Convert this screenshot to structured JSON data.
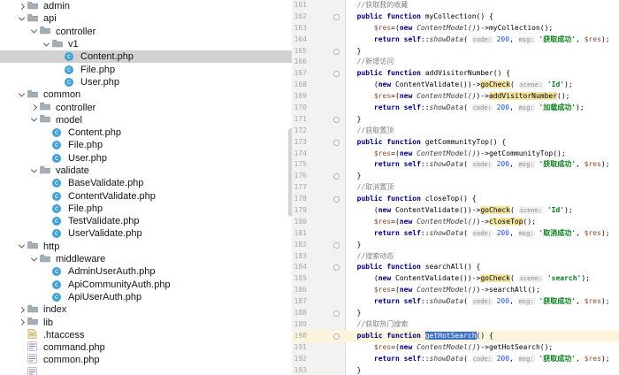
{
  "colors": {
    "tree_selection": "#D2D2D2",
    "caret_line": "#FCF5DB",
    "usage_highlight": "#F6E6A2",
    "selection_blue": "#3B6EC6",
    "keyword": "#000080",
    "string_green": "#067D17",
    "number_blue": "#1750EB",
    "variable_brown": "#8B4A2F",
    "comment_gray": "#808080",
    "class_icon_blue": "#41A1D3",
    "gutter_bg": "#F2F2F1"
  },
  "tree": {
    "items": [
      {
        "label": "admin",
        "level": 0,
        "kind": "folder",
        "chevron": "collapsed",
        "selected": false
      },
      {
        "label": "api",
        "level": 0,
        "kind": "folder",
        "chevron": "expanded",
        "selected": false
      },
      {
        "label": "controller",
        "level": 1,
        "kind": "folder",
        "chevron": "expanded",
        "selected": false
      },
      {
        "label": "v1",
        "level": 2,
        "kind": "folder",
        "chevron": "expanded",
        "selected": false
      },
      {
        "label": "Content.php",
        "level": 3,
        "kind": "class",
        "chevron": "none",
        "selected": true
      },
      {
        "label": "File.php",
        "level": 3,
        "kind": "class",
        "chevron": "none",
        "selected": false
      },
      {
        "label": "User.php",
        "level": 3,
        "kind": "class",
        "chevron": "none",
        "selected": false
      },
      {
        "label": "common",
        "level": 0,
        "kind": "folder",
        "chevron": "expanded",
        "selected": false
      },
      {
        "label": "controller",
        "level": 1,
        "kind": "folder",
        "chevron": "collapsed",
        "selected": false
      },
      {
        "label": "model",
        "level": 1,
        "kind": "folder",
        "chevron": "expanded",
        "selected": false
      },
      {
        "label": "Content.php",
        "level": 2,
        "kind": "class",
        "chevron": "none",
        "selected": false
      },
      {
        "label": "File.php",
        "level": 2,
        "kind": "class",
        "chevron": "none",
        "selected": false
      },
      {
        "label": "User.php",
        "level": 2,
        "kind": "class",
        "chevron": "none",
        "selected": false
      },
      {
        "label": "validate",
        "level": 1,
        "kind": "folder",
        "chevron": "expanded",
        "selected": false
      },
      {
        "label": "BaseValidate.php",
        "level": 2,
        "kind": "class",
        "chevron": "none",
        "selected": false
      },
      {
        "label": "ContentValidate.php",
        "level": 2,
        "kind": "class",
        "chevron": "none",
        "selected": false
      },
      {
        "label": "File.php",
        "level": 2,
        "kind": "class",
        "chevron": "none",
        "selected": false
      },
      {
        "label": "TestValidate.php",
        "level": 2,
        "kind": "class",
        "chevron": "none",
        "selected": false
      },
      {
        "label": "UserValidate.php",
        "level": 2,
        "kind": "class",
        "chevron": "none",
        "selected": false
      },
      {
        "label": "http",
        "level": 0,
        "kind": "folder",
        "chevron": "expanded",
        "selected": false
      },
      {
        "label": "middleware",
        "level": 1,
        "kind": "folder",
        "chevron": "expanded",
        "selected": false
      },
      {
        "label": "AdminUserAuth.php",
        "level": 2,
        "kind": "class",
        "chevron": "none",
        "selected": false
      },
      {
        "label": "ApiCommunityAuth.php",
        "level": 2,
        "kind": "class",
        "chevron": "none",
        "selected": false
      },
      {
        "label": "ApiUserAuth.php",
        "level": 2,
        "kind": "class",
        "chevron": "none",
        "selected": false
      },
      {
        "label": "index",
        "level": 0,
        "kind": "folder",
        "chevron": "collapsed",
        "selected": false
      },
      {
        "label": "lib",
        "level": 0,
        "kind": "folder",
        "chevron": "collapsed",
        "selected": false
      },
      {
        "label": ".htaccess",
        "level": 0,
        "kind": "htaccess",
        "chevron": "none",
        "selected": false
      },
      {
        "label": "command.php",
        "level": 0,
        "kind": "phpfile",
        "chevron": "none",
        "selected": false
      },
      {
        "label": "common.php",
        "level": 0,
        "kind": "phpfile",
        "chevron": "none",
        "selected": false
      },
      {
        "label": "",
        "level": 0,
        "kind": "phpfile",
        "chevron": "none",
        "selected": false
      }
    ]
  },
  "editor": {
    "caret_line": 190,
    "lines": [
      {
        "num": 161,
        "tokens": [
          [
            "cmt",
            "  //获取我的收藏"
          ]
        ]
      },
      {
        "num": 162,
        "fold": "start",
        "tokens": [
          [
            "kw",
            "  public function"
          ],
          [
            "pl",
            " "
          ],
          [
            "fn",
            "myCollection"
          ],
          [
            "pl",
            "() {"
          ]
        ]
      },
      {
        "num": 163,
        "tokens": [
          [
            "pl",
            "      "
          ],
          [
            "var",
            "$res"
          ],
          [
            "pl",
            "=("
          ],
          [
            "kw",
            "new"
          ],
          [
            "pl",
            " "
          ],
          [
            "cls",
            "ContentModel()"
          ],
          [
            "pl",
            ")->myCollection();"
          ]
        ]
      },
      {
        "num": 164,
        "tokens": [
          [
            "pl",
            "      "
          ],
          [
            "kw",
            "return self"
          ],
          [
            "pl",
            "::"
          ],
          [
            "cls",
            "showData"
          ],
          [
            "pl",
            "( "
          ],
          [
            "hint",
            "code:"
          ],
          [
            "pl",
            " "
          ],
          [
            "num",
            "200"
          ],
          [
            "pl",
            ", "
          ],
          [
            "hint",
            "msg:"
          ],
          [
            "pl",
            " "
          ],
          [
            "str",
            "'获取成功'"
          ],
          [
            "pl",
            ", "
          ],
          [
            "var",
            "$res"
          ],
          [
            "pl",
            ");"
          ]
        ]
      },
      {
        "num": 165,
        "fold": "end",
        "tokens": [
          [
            "pl",
            "  }"
          ]
        ]
      },
      {
        "num": 166,
        "tokens": [
          [
            "cmt",
            "  //新增访问"
          ]
        ]
      },
      {
        "num": 167,
        "fold": "start",
        "tokens": [
          [
            "kw",
            "  public function"
          ],
          [
            "pl",
            " "
          ],
          [
            "fn",
            "addVisitorNumber"
          ],
          [
            "pl",
            "() {"
          ]
        ]
      },
      {
        "num": 168,
        "tokens": [
          [
            "pl",
            "      ("
          ],
          [
            "kw",
            "new"
          ],
          [
            "pl",
            " ContentValidate())->"
          ],
          [
            "hl",
            "goCheck"
          ],
          [
            "pl",
            "( "
          ],
          [
            "hint",
            "scene:"
          ],
          [
            "pl",
            " "
          ],
          [
            "str",
            "'Id'"
          ],
          [
            "pl",
            ");"
          ]
        ]
      },
      {
        "num": 169,
        "tokens": [
          [
            "pl",
            "      "
          ],
          [
            "var",
            "$res"
          ],
          [
            "pl",
            "=("
          ],
          [
            "kw",
            "new"
          ],
          [
            "pl",
            " "
          ],
          [
            "cls",
            "ContentModel()"
          ],
          [
            "pl",
            ")->"
          ],
          [
            "hl",
            "addVisitorNumber"
          ],
          [
            "pl",
            "();"
          ]
        ]
      },
      {
        "num": 170,
        "tokens": [
          [
            "pl",
            "      "
          ],
          [
            "kw",
            "return self"
          ],
          [
            "pl",
            "::"
          ],
          [
            "cls",
            "showData"
          ],
          [
            "pl",
            "( "
          ],
          [
            "hint",
            "code:"
          ],
          [
            "pl",
            " "
          ],
          [
            "num",
            "200"
          ],
          [
            "pl",
            ", "
          ],
          [
            "hint",
            "msg:"
          ],
          [
            "pl",
            " "
          ],
          [
            "str",
            "'加载成功'"
          ],
          [
            "pl",
            ");"
          ]
        ]
      },
      {
        "num": 171,
        "fold": "end",
        "tokens": [
          [
            "pl",
            "  }"
          ]
        ]
      },
      {
        "num": 172,
        "tokens": [
          [
            "cmt",
            "  //获取置顶"
          ]
        ]
      },
      {
        "num": 173,
        "fold": "start",
        "tokens": [
          [
            "kw",
            "  public function"
          ],
          [
            "pl",
            " "
          ],
          [
            "fn",
            "getCommunityTop"
          ],
          [
            "pl",
            "() {"
          ]
        ]
      },
      {
        "num": 174,
        "tokens": [
          [
            "pl",
            "      "
          ],
          [
            "var",
            "$res"
          ],
          [
            "pl",
            "=("
          ],
          [
            "kw",
            "new"
          ],
          [
            "pl",
            " "
          ],
          [
            "cls",
            "ContentModel()"
          ],
          [
            "pl",
            ")->getCommunityTop();"
          ]
        ]
      },
      {
        "num": 175,
        "tokens": [
          [
            "pl",
            "      "
          ],
          [
            "kw",
            "return self"
          ],
          [
            "pl",
            "::"
          ],
          [
            "cls",
            "showData"
          ],
          [
            "pl",
            "( "
          ],
          [
            "hint",
            "code:"
          ],
          [
            "pl",
            " "
          ],
          [
            "num",
            "200"
          ],
          [
            "pl",
            ", "
          ],
          [
            "hint",
            "msg:"
          ],
          [
            "pl",
            " "
          ],
          [
            "str",
            "'获取成功'"
          ],
          [
            "pl",
            ", "
          ],
          [
            "var",
            "$res"
          ],
          [
            "pl",
            ");"
          ]
        ]
      },
      {
        "num": 176,
        "fold": "end",
        "tokens": [
          [
            "pl",
            "  }"
          ]
        ]
      },
      {
        "num": 177,
        "tokens": [
          [
            "cmt",
            "  //取消置顶"
          ]
        ]
      },
      {
        "num": 178,
        "fold": "start",
        "tokens": [
          [
            "kw",
            "  public function"
          ],
          [
            "pl",
            " "
          ],
          [
            "fn",
            "closeTop"
          ],
          [
            "pl",
            "() {"
          ]
        ]
      },
      {
        "num": 179,
        "tokens": [
          [
            "pl",
            "      ("
          ],
          [
            "kw",
            "new"
          ],
          [
            "pl",
            " ContentValidate())->"
          ],
          [
            "hl",
            "goCheck"
          ],
          [
            "pl",
            "( "
          ],
          [
            "hint",
            "scene:"
          ],
          [
            "pl",
            " "
          ],
          [
            "str",
            "'Id'"
          ],
          [
            "pl",
            ");"
          ]
        ]
      },
      {
        "num": 180,
        "tokens": [
          [
            "pl",
            "      "
          ],
          [
            "var",
            "$res"
          ],
          [
            "pl",
            "=("
          ],
          [
            "kw",
            "new"
          ],
          [
            "pl",
            " "
          ],
          [
            "cls",
            "ContentModel()"
          ],
          [
            "pl",
            ")->"
          ],
          [
            "hl",
            "closeTop"
          ],
          [
            "pl",
            "();"
          ]
        ]
      },
      {
        "num": 181,
        "tokens": [
          [
            "pl",
            "      "
          ],
          [
            "kw",
            "return self"
          ],
          [
            "pl",
            "::"
          ],
          [
            "cls",
            "showData"
          ],
          [
            "pl",
            "( "
          ],
          [
            "hint",
            "code:"
          ],
          [
            "pl",
            " "
          ],
          [
            "num",
            "200"
          ],
          [
            "pl",
            ", "
          ],
          [
            "hint",
            "msg:"
          ],
          [
            "pl",
            " "
          ],
          [
            "str",
            "'取消成功'"
          ],
          [
            "pl",
            ", "
          ],
          [
            "var",
            "$res"
          ],
          [
            "pl",
            ");"
          ]
        ]
      },
      {
        "num": 182,
        "fold": "end",
        "tokens": [
          [
            "pl",
            "  }"
          ]
        ]
      },
      {
        "num": 183,
        "tokens": [
          [
            "cmt",
            "  //搜索动态"
          ]
        ]
      },
      {
        "num": 184,
        "fold": "start",
        "tokens": [
          [
            "kw",
            "  public function"
          ],
          [
            "pl",
            " "
          ],
          [
            "fn",
            "searchAll"
          ],
          [
            "pl",
            "() {"
          ]
        ]
      },
      {
        "num": 185,
        "tokens": [
          [
            "pl",
            "      ("
          ],
          [
            "kw",
            "new"
          ],
          [
            "pl",
            " ContentValidate())->"
          ],
          [
            "hl",
            "goCheck"
          ],
          [
            "pl",
            "( "
          ],
          [
            "hint",
            "scene:"
          ],
          [
            "pl",
            " "
          ],
          [
            "str",
            "'search'"
          ],
          [
            "pl",
            ");"
          ]
        ]
      },
      {
        "num": 186,
        "tokens": [
          [
            "pl",
            "      "
          ],
          [
            "var",
            "$res"
          ],
          [
            "pl",
            "=("
          ],
          [
            "kw",
            "new"
          ],
          [
            "pl",
            " "
          ],
          [
            "cls",
            "ContentModel()"
          ],
          [
            "pl",
            ")->searchAll();"
          ]
        ]
      },
      {
        "num": 187,
        "tokens": [
          [
            "pl",
            "      "
          ],
          [
            "kw",
            "return self"
          ],
          [
            "pl",
            "::"
          ],
          [
            "cls",
            "showData"
          ],
          [
            "pl",
            "( "
          ],
          [
            "hint",
            "code:"
          ],
          [
            "pl",
            " "
          ],
          [
            "num",
            "200"
          ],
          [
            "pl",
            ", "
          ],
          [
            "hint",
            "msg:"
          ],
          [
            "pl",
            " "
          ],
          [
            "str",
            "'获取成功'"
          ],
          [
            "pl",
            ", "
          ],
          [
            "var",
            "$res"
          ],
          [
            "pl",
            ");"
          ]
        ]
      },
      {
        "num": 188,
        "fold": "end",
        "tokens": [
          [
            "pl",
            "  }"
          ]
        ]
      },
      {
        "num": 189,
        "tokens": [
          [
            "cmt",
            "  //获取热门搜索"
          ]
        ]
      },
      {
        "num": 190,
        "fold": "start",
        "caret": true,
        "tokens": [
          [
            "kw",
            "  public function"
          ],
          [
            "pl",
            " "
          ],
          [
            "sel",
            "getHotSearch"
          ],
          [
            "pl",
            "() {"
          ]
        ]
      },
      {
        "num": 191,
        "tokens": [
          [
            "pl",
            "      "
          ],
          [
            "var",
            "$res"
          ],
          [
            "pl",
            "=("
          ],
          [
            "kw",
            "new"
          ],
          [
            "pl",
            " "
          ],
          [
            "cls",
            "ContentModel()"
          ],
          [
            "pl",
            ")->getHotSearch();"
          ]
        ]
      },
      {
        "num": 192,
        "tokens": [
          [
            "pl",
            "      "
          ],
          [
            "kw",
            "return self"
          ],
          [
            "pl",
            "::"
          ],
          [
            "cls",
            "showData"
          ],
          [
            "pl",
            "( "
          ],
          [
            "hint",
            "code:"
          ],
          [
            "pl",
            " "
          ],
          [
            "num",
            "200"
          ],
          [
            "pl",
            ", "
          ],
          [
            "hint",
            "msg:"
          ],
          [
            "pl",
            " "
          ],
          [
            "str",
            "'获取成功'"
          ],
          [
            "pl",
            ", "
          ],
          [
            "var",
            "$res"
          ],
          [
            "pl",
            ");"
          ]
        ]
      },
      {
        "num": 193,
        "tokens": [
          [
            "pl",
            "  }"
          ]
        ]
      }
    ]
  }
}
